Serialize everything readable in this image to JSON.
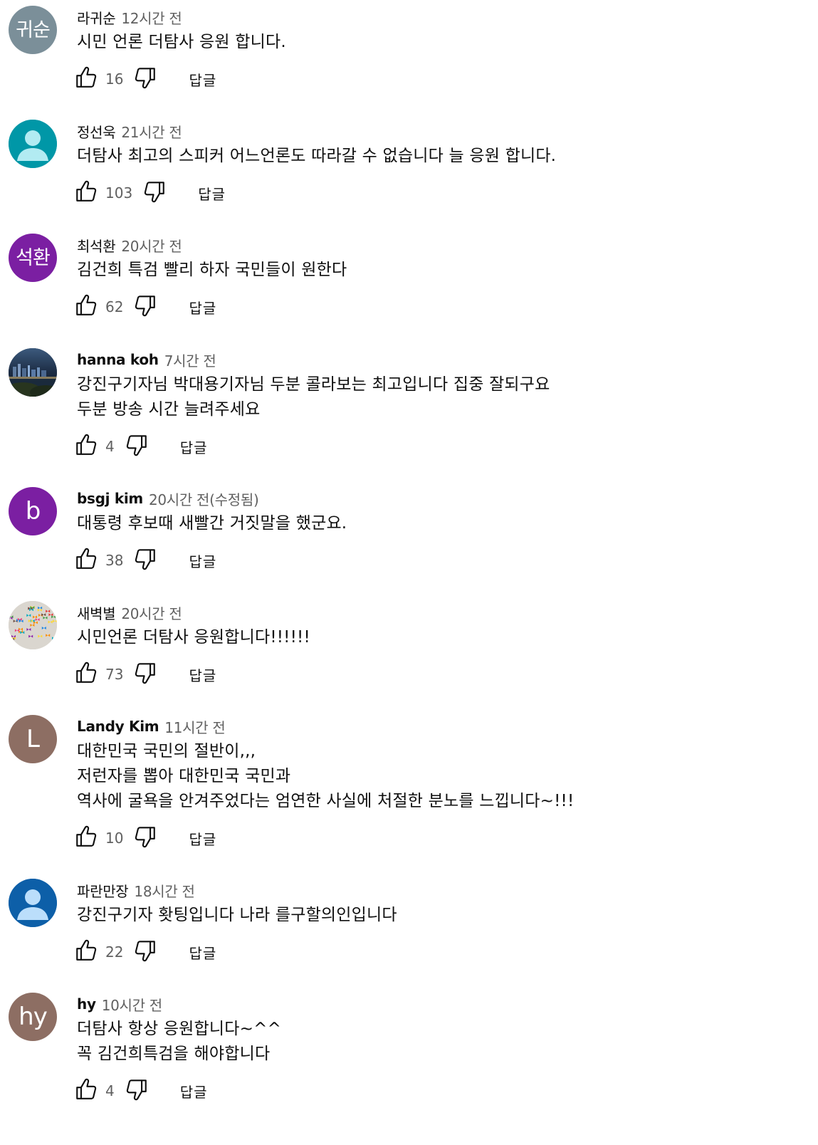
{
  "comments": [
    {
      "avatar": {
        "type": "initials",
        "text": "귀순",
        "bg": "#7b8f99"
      },
      "author": "라귀순",
      "author_bold": false,
      "time": "12시간 전",
      "lines": [
        "시민 언론 더탐사 응원 합니다."
      ],
      "likes": "16",
      "reply": "답글"
    },
    {
      "avatar": {
        "type": "person-icon",
        "text": "",
        "bg": "#0097a7",
        "fg": "#b2ebf2"
      },
      "author": "정선욱",
      "author_bold": false,
      "time": "21시간 전",
      "lines": [
        "더탐사  최고의 스피커  어느언론도 따라갈 수 없습니다  늘 응원 합니다."
      ],
      "likes": "103",
      "reply": "답글"
    },
    {
      "avatar": {
        "type": "initials",
        "text": "석환",
        "bg": "#7b1fa2"
      },
      "author": "최석환",
      "author_bold": false,
      "time": "20시간 전",
      "lines": [
        "김건희 특검 빨리 하자 국민들이 원한다"
      ],
      "likes": "62",
      "reply": "답글"
    },
    {
      "avatar": {
        "type": "photo-night-city",
        "text": "",
        "bg": "#1d3148"
      },
      "author": "hanna koh",
      "author_bold": true,
      "time": "7시간 전",
      "lines": [
        "강진구기자님 박대용기자님 두분 콜라보는 최고입니다 집중 잘되구요",
        "두분 방송 시간 늘려주세요"
      ],
      "likes": "4",
      "reply": "답글"
    },
    {
      "avatar": {
        "type": "initials",
        "text": "b",
        "bg": "#7b1fa2"
      },
      "author": "bsgj kim",
      "author_bold": true,
      "time": "20시간 전(수정됨)",
      "lines": [
        "대통령 후보때 새빨간 거짓말을 했군요."
      ],
      "likes": "38",
      "reply": "답글"
    },
    {
      "avatar": {
        "type": "photo-butterflies",
        "text": "",
        "bg": "#d8d4cc"
      },
      "author": "새벽별",
      "author_bold": false,
      "time": "20시간 전",
      "lines": [
        "시민언론 더탐사 응원합니다!!!!!!"
      ],
      "likes": "73",
      "reply": "답글"
    },
    {
      "avatar": {
        "type": "initials",
        "text": "L",
        "bg": "#8d6e63"
      },
      "author": "Landy Kim",
      "author_bold": true,
      "time": "11시간 전",
      "lines": [
        "대한민국 국민의 절반이,,,",
        "저런자를 뽑아 대한민국 국민과",
        "역사에 굴욕을 안겨주었다는 엄연한 사실에 처절한 분노를 느낍니다~!!!"
      ],
      "likes": "10",
      "reply": "답글"
    },
    {
      "avatar": {
        "type": "person-icon",
        "text": "",
        "bg": "#0d5fa8",
        "fg": "#bbdefb"
      },
      "author": "파란만장",
      "author_bold": false,
      "time": "18시간 전",
      "lines": [
        "강진구기자 홧팅입니다 나라 를구할의인입니다"
      ],
      "likes": "22",
      "reply": "답글"
    },
    {
      "avatar": {
        "type": "initials",
        "text": "hy",
        "bg": "#8d6e63"
      },
      "author": "hy",
      "author_bold": true,
      "time": "10시간 전",
      "lines": [
        "더탐사 항상 응원합니다~^^",
        "꼭 김건희특검을 해야합니다"
      ],
      "likes": "4",
      "reply": "답글"
    }
  ]
}
